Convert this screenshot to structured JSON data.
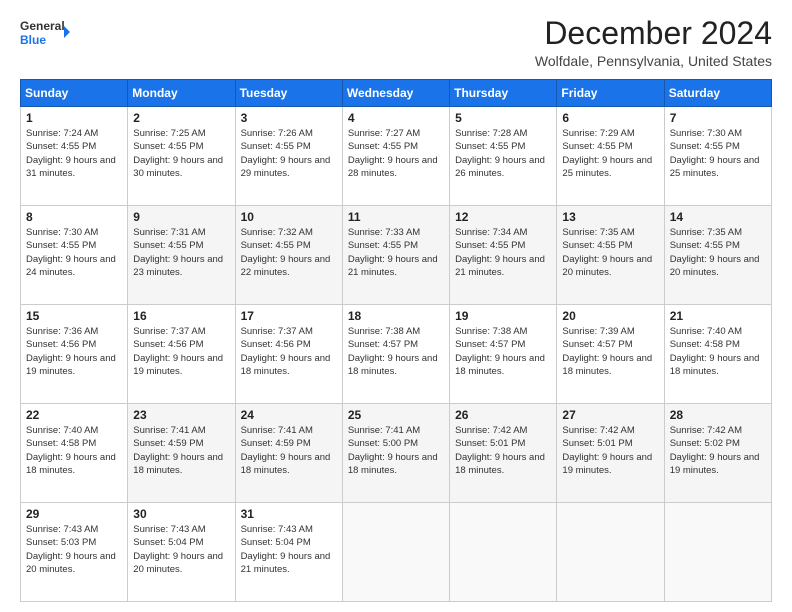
{
  "logo": {
    "line1": "General",
    "line2": "Blue",
    "arrow_color": "#1a73e8"
  },
  "title": "December 2024",
  "subtitle": "Wolfdale, Pennsylvania, United States",
  "days_header": [
    "Sunday",
    "Monday",
    "Tuesday",
    "Wednesday",
    "Thursday",
    "Friday",
    "Saturday"
  ],
  "weeks": [
    [
      {
        "num": "1",
        "sunrise": "7:24 AM",
        "sunset": "4:55 PM",
        "daylight": "9 hours and 31 minutes."
      },
      {
        "num": "2",
        "sunrise": "7:25 AM",
        "sunset": "4:55 PM",
        "daylight": "9 hours and 30 minutes."
      },
      {
        "num": "3",
        "sunrise": "7:26 AM",
        "sunset": "4:55 PM",
        "daylight": "9 hours and 29 minutes."
      },
      {
        "num": "4",
        "sunrise": "7:27 AM",
        "sunset": "4:55 PM",
        "daylight": "9 hours and 28 minutes."
      },
      {
        "num": "5",
        "sunrise": "7:28 AM",
        "sunset": "4:55 PM",
        "daylight": "9 hours and 26 minutes."
      },
      {
        "num": "6",
        "sunrise": "7:29 AM",
        "sunset": "4:55 PM",
        "daylight": "9 hours and 25 minutes."
      },
      {
        "num": "7",
        "sunrise": "7:30 AM",
        "sunset": "4:55 PM",
        "daylight": "9 hours and 25 minutes."
      }
    ],
    [
      {
        "num": "8",
        "sunrise": "7:30 AM",
        "sunset": "4:55 PM",
        "daylight": "9 hours and 24 minutes."
      },
      {
        "num": "9",
        "sunrise": "7:31 AM",
        "sunset": "4:55 PM",
        "daylight": "9 hours and 23 minutes."
      },
      {
        "num": "10",
        "sunrise": "7:32 AM",
        "sunset": "4:55 PM",
        "daylight": "9 hours and 22 minutes."
      },
      {
        "num": "11",
        "sunrise": "7:33 AM",
        "sunset": "4:55 PM",
        "daylight": "9 hours and 21 minutes."
      },
      {
        "num": "12",
        "sunrise": "7:34 AM",
        "sunset": "4:55 PM",
        "daylight": "9 hours and 21 minutes."
      },
      {
        "num": "13",
        "sunrise": "7:35 AM",
        "sunset": "4:55 PM",
        "daylight": "9 hours and 20 minutes."
      },
      {
        "num": "14",
        "sunrise": "7:35 AM",
        "sunset": "4:55 PM",
        "daylight": "9 hours and 20 minutes."
      }
    ],
    [
      {
        "num": "15",
        "sunrise": "7:36 AM",
        "sunset": "4:56 PM",
        "daylight": "9 hours and 19 minutes."
      },
      {
        "num": "16",
        "sunrise": "7:37 AM",
        "sunset": "4:56 PM",
        "daylight": "9 hours and 19 minutes."
      },
      {
        "num": "17",
        "sunrise": "7:37 AM",
        "sunset": "4:56 PM",
        "daylight": "9 hours and 18 minutes."
      },
      {
        "num": "18",
        "sunrise": "7:38 AM",
        "sunset": "4:57 PM",
        "daylight": "9 hours and 18 minutes."
      },
      {
        "num": "19",
        "sunrise": "7:38 AM",
        "sunset": "4:57 PM",
        "daylight": "9 hours and 18 minutes."
      },
      {
        "num": "20",
        "sunrise": "7:39 AM",
        "sunset": "4:57 PM",
        "daylight": "9 hours and 18 minutes."
      },
      {
        "num": "21",
        "sunrise": "7:40 AM",
        "sunset": "4:58 PM",
        "daylight": "9 hours and 18 minutes."
      }
    ],
    [
      {
        "num": "22",
        "sunrise": "7:40 AM",
        "sunset": "4:58 PM",
        "daylight": "9 hours and 18 minutes."
      },
      {
        "num": "23",
        "sunrise": "7:41 AM",
        "sunset": "4:59 PM",
        "daylight": "9 hours and 18 minutes."
      },
      {
        "num": "24",
        "sunrise": "7:41 AM",
        "sunset": "4:59 PM",
        "daylight": "9 hours and 18 minutes."
      },
      {
        "num": "25",
        "sunrise": "7:41 AM",
        "sunset": "5:00 PM",
        "daylight": "9 hours and 18 minutes."
      },
      {
        "num": "26",
        "sunrise": "7:42 AM",
        "sunset": "5:01 PM",
        "daylight": "9 hours and 18 minutes."
      },
      {
        "num": "27",
        "sunrise": "7:42 AM",
        "sunset": "5:01 PM",
        "daylight": "9 hours and 19 minutes."
      },
      {
        "num": "28",
        "sunrise": "7:42 AM",
        "sunset": "5:02 PM",
        "daylight": "9 hours and 19 minutes."
      }
    ],
    [
      {
        "num": "29",
        "sunrise": "7:43 AM",
        "sunset": "5:03 PM",
        "daylight": "9 hours and 20 minutes."
      },
      {
        "num": "30",
        "sunrise": "7:43 AM",
        "sunset": "5:04 PM",
        "daylight": "9 hours and 20 minutes."
      },
      {
        "num": "31",
        "sunrise": "7:43 AM",
        "sunset": "5:04 PM",
        "daylight": "9 hours and 21 minutes."
      },
      null,
      null,
      null,
      null
    ]
  ]
}
